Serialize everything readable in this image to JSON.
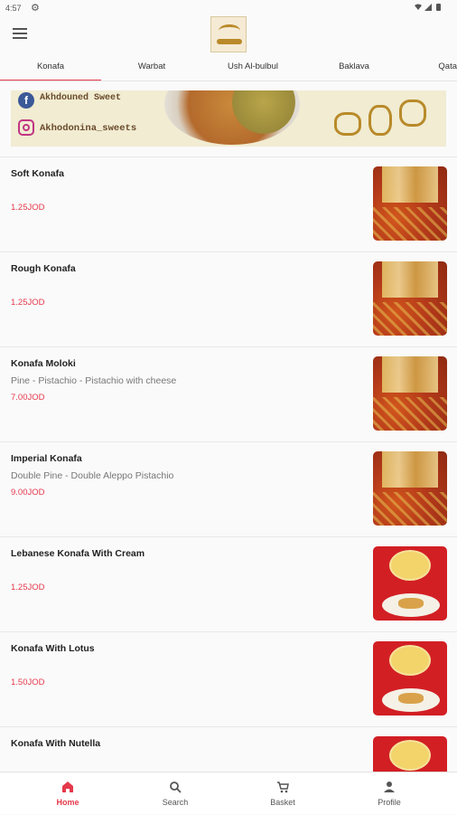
{
  "status": {
    "time": "4:57"
  },
  "tabs": [
    {
      "label": "Konafa",
      "active": true
    },
    {
      "label": "Warbat",
      "active": false
    },
    {
      "label": "Ush Al-bulbul",
      "active": false
    },
    {
      "label": "Baklava",
      "active": false
    },
    {
      "label": "Qata",
      "active": false
    }
  ],
  "banner": {
    "facebook_text": "Akhdouned Sweet",
    "instagram_text": "Akhodonina_sweets"
  },
  "products": [
    {
      "name": "Soft Konafa",
      "desc": "",
      "price": "1.25JOD",
      "image": "konafa-orange"
    },
    {
      "name": "Rough Konafa",
      "desc": "",
      "price": "1.25JOD",
      "image": "konafa-orange"
    },
    {
      "name": "Konafa Moloki",
      "desc": "Pine - Pistachio - Pistachio with cheese",
      "price": "7.00JOD",
      "image": "konafa-orange"
    },
    {
      "name": "Imperial Konafa",
      "desc": "Double Pine - Double Aleppo Pistachio",
      "price": "9.00JOD",
      "image": "konafa-orange"
    },
    {
      "name": "Lebanese Konafa With Cream",
      "desc": "",
      "price": "1.25JOD",
      "image": "red-plate"
    },
    {
      "name": "Konafa With Lotus",
      "desc": "",
      "price": "1.50JOD",
      "image": "red-plate"
    },
    {
      "name": "Konafa With Nutella",
      "desc": "",
      "price": "",
      "image": "red-plate"
    }
  ],
  "bottom_nav": [
    {
      "label": "Home",
      "icon": "home-icon",
      "active": true
    },
    {
      "label": "Search",
      "icon": "search-icon",
      "active": false
    },
    {
      "label": "Basket",
      "icon": "cart-icon",
      "active": false
    },
    {
      "label": "Profile",
      "icon": "person-icon",
      "active": false
    }
  ],
  "colors": {
    "accent": "#e5394b",
    "price": "#e5394b"
  }
}
